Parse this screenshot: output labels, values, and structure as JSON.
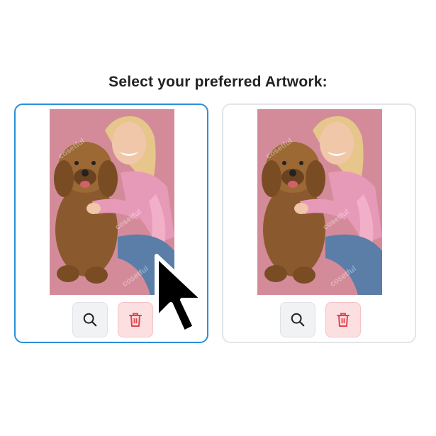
{
  "heading": "Select your preferred Artwork:",
  "watermark_text": "cosetful",
  "colors": {
    "selected_border": "#2b8fdb",
    "unselected_border": "#e3e5e8",
    "artwork_background": "#d48b99",
    "delete_button_bg": "#fbdfe1",
    "delete_icon": "#e0434f",
    "zoom_button_bg": "#f1f2f4"
  },
  "artworks": [
    {
      "selected": true,
      "zoom_icon": "search-icon",
      "delete_icon": "trash-icon"
    },
    {
      "selected": false,
      "zoom_icon": "search-icon",
      "delete_icon": "trash-icon"
    }
  ],
  "cursor_icon": "arrow-cursor-icon"
}
